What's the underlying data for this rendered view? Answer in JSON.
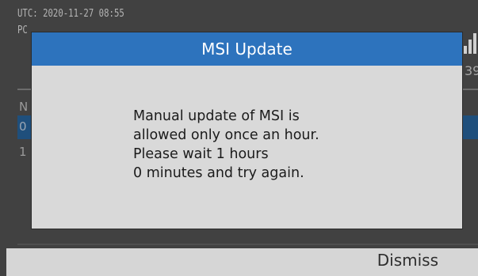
{
  "background": {
    "status_line": "UTC:  2020-11-27  08:55",
    "partial_label_top": "PC",
    "partial_label_right": "39",
    "list_header_partial": "N",
    "highlighted_row_partial": "0",
    "row_partial": "1"
  },
  "dialog": {
    "title": "MSI Update",
    "message_lines": [
      "Manual update of MSI is",
      "allowed only once an hour.",
      "Please wait 1 hours",
      "0 minutes and try again."
    ]
  },
  "softkeys": {
    "dismiss_label": "Dismiss"
  },
  "colors": {
    "dialog_header": "#2d73bd",
    "dialog_body": "#d9d9d9",
    "softkey_bar": "#d6d6d6",
    "background": "#414141"
  }
}
